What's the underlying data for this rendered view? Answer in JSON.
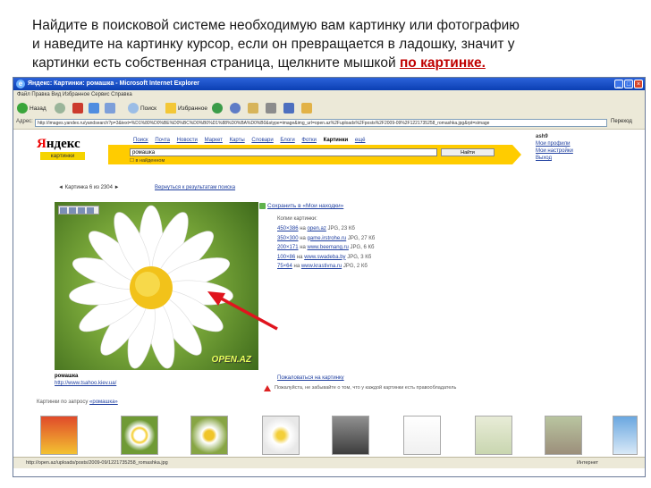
{
  "caption": {
    "line1": "Найдите в поисковой системе необходимую вам картинку или фотографию",
    "line2": "и наведите на картинку курсор, если он превращается в ладошку, значит у",
    "line3_text": "картинки есть собственная страница, щелкните мышкой ",
    "line3_link": "по картинке."
  },
  "window": {
    "title": "Яндекс: Картинки: ромашка - Microsoft Internet Explorer",
    "menu": "Файл   Правка   Вид   Избранное   Сервис   Справка",
    "toolbar": {
      "back": "Назад",
      "search": "Поиск",
      "favorites": "Избранное"
    },
    "address_label": "Адрес:",
    "address_value": "http://images.yandex.ru/yandsearch?p=3&text=%D1%80%D0%BE%D0%BC%D0%B0%D1%88%D0%BA%D0%B0&stype=image&img_url=open.az%2Fuploads%2Fposts%2F2009-09%2F1221735258_romashka.jpg&rpt=simage",
    "go": "Переход",
    "status_url": "http://open.az/uploads/posts/2009-09/1221735258_romashka.jpg",
    "status_zone": "Интернет"
  },
  "yandex": {
    "logo_ya": "Я",
    "logo_rest": "ндекс",
    "logo_sub": "картинки",
    "nav": [
      "Поиск",
      "Почта",
      "Новости",
      "Маркет",
      "Карты",
      "Словари",
      "Блоги",
      "Фотки",
      "Картинки",
      "ещё"
    ],
    "search_value": "ромашка",
    "search_button": "Найти",
    "checkbox": "в найденном",
    "user": "ash9",
    "user_links": [
      "Мои профили",
      "Мои настройки",
      "Выход"
    ]
  },
  "viewer": {
    "prev": "◄ Картинка 6 из 2304 ►",
    "back": "Вернуться к результатам поиска",
    "watermark": "OPEN.AZ",
    "title": "ромашка",
    "url": "http://www.tsahoo.kiev.ua/",
    "save": "Сохранить в «Мои находки»",
    "other_sizes": "Копии картинки:",
    "sizes": [
      {
        "size": "450×386",
        "site": "open.az",
        "info": " JPG, 23 Кб"
      },
      {
        "size": "350×300",
        "site": "game.irstrohe.ru",
        "info": " JPG, 27 Кб"
      },
      {
        "size": "200×171",
        "site": "www.beemang.ru",
        "info": " JPG, 6 Кб"
      },
      {
        "size": "100×86",
        "site": "www.swadeba.by",
        "info": " JPG, 3 Кб"
      },
      {
        "size": "75×64",
        "site": "www.krastivna.ru",
        "info": " JPG, 2 Кб"
      }
    ],
    "complain": "Пожаловаться на картинку",
    "warning": "Пожалуйста, не забывайте о том, что у каждой картинки есть правообладатель",
    "similar_label": "Картинки по запросу ",
    "similar_query": "«ромашка»"
  },
  "colors": {
    "yandex_yellow": "#ffcc00",
    "link_blue": "#1f3fa0",
    "caption_link": "#c00000",
    "arrow_red": "#e0141e"
  }
}
